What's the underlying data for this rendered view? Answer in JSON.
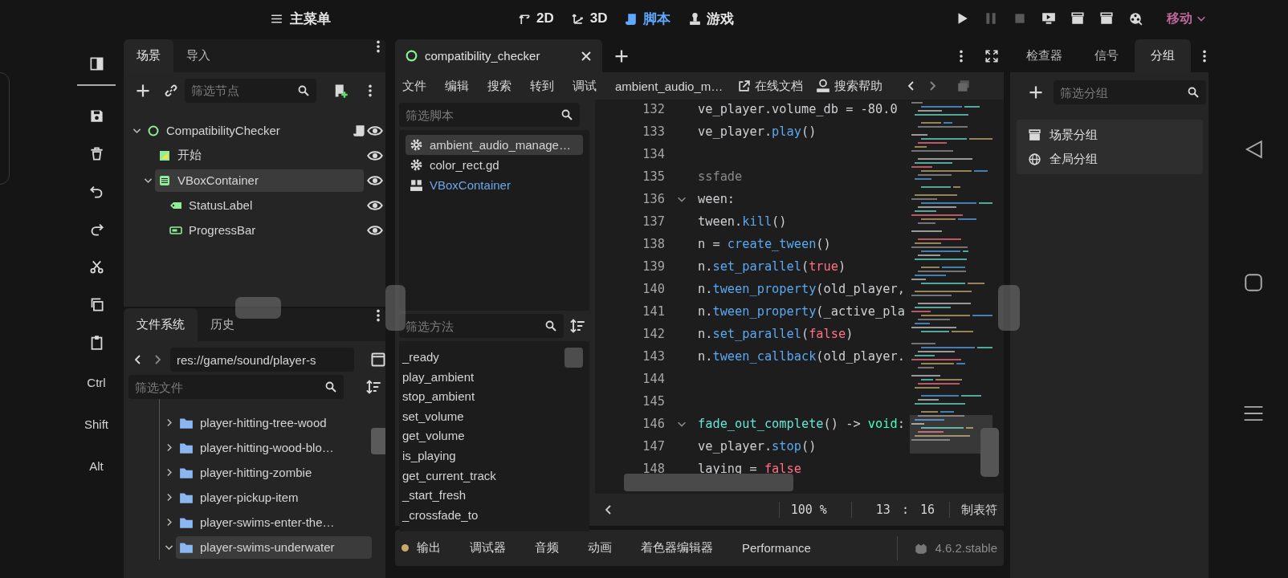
{
  "main_menu": "主菜单",
  "workspaces": [
    {
      "label": "2D",
      "selected": false
    },
    {
      "label": "3D",
      "selected": false
    },
    {
      "label": "脚本",
      "selected": true
    },
    {
      "label": "游戏",
      "selected": false
    }
  ],
  "run_controls": [
    {
      "disabled": false
    },
    {
      "disabled": true
    },
    {
      "disabled": true
    },
    {
      "disabled": false
    },
    {
      "disabled": false
    },
    {
      "disabled": false
    },
    {
      "disabled": false
    }
  ],
  "mode": "移动",
  "modifier_keys": [
    "Ctrl",
    "Shift",
    "Alt"
  ],
  "scene_dock": {
    "tabs": [
      {
        "label": "场景",
        "selected": true
      },
      {
        "label": "导入",
        "selected": false
      }
    ],
    "filter_placeholder": "筛选节点",
    "tree": [
      {
        "name": "CompatibilityChecker",
        "kind": "node",
        "selected": false,
        "visible": true,
        "has_script": true,
        "expanded": true,
        "children": [
          {
            "name": "开始",
            "kind": "color_rect",
            "selected": false,
            "visible": true,
            "has_script": false
          },
          {
            "name": "VBoxContainer",
            "kind": "vbox",
            "selected": true,
            "visible": true,
            "has_script": false,
            "expanded": true,
            "children": [
              {
                "name": "StatusLabel",
                "kind": "label",
                "selected": false,
                "visible": true,
                "has_script": false
              },
              {
                "name": "ProgressBar",
                "kind": "progress_bar",
                "selected": false,
                "visible": true,
                "has_script": false
              }
            ]
          }
        ]
      }
    ]
  },
  "filesystem_dock": {
    "tabs": [
      {
        "label": "文件系统",
        "selected": true
      },
      {
        "label": "历史",
        "selected": false
      }
    ],
    "path": "res://game/sound/player-s",
    "filter_placeholder": "筛选文件",
    "items": [
      {
        "name": "player-hitting-tree-wood",
        "selected": false,
        "expanded": false
      },
      {
        "name": "player-hitting-wood-blo…",
        "selected": false,
        "expanded": false
      },
      {
        "name": "player-hitting-zombie",
        "selected": false,
        "expanded": false
      },
      {
        "name": "player-pickup-item",
        "selected": false,
        "expanded": false
      },
      {
        "name": "player-swims-enter-the…",
        "selected": false,
        "expanded": false
      },
      {
        "name": "player-swims-underwater",
        "selected": true,
        "expanded": true
      }
    ]
  },
  "script_editor": {
    "tabs": [
      {
        "label": "compatibility_checker",
        "selected": true
      }
    ],
    "menu": [
      "文件",
      "编辑",
      "搜索",
      "转到",
      "调试"
    ],
    "current_script": "ambient_audio_m…",
    "online_docs": "在线文档",
    "search_help": "搜索帮助",
    "script_filter_placeholder": "筛选脚本",
    "scripts": [
      {
        "name": "ambient_audio_manage…",
        "kind": "script",
        "selected": true
      },
      {
        "name": "color_rect.gd",
        "kind": "script",
        "selected": false
      },
      {
        "name": "VBoxContainer",
        "kind": "doc",
        "selected": false
      }
    ],
    "method_filter_placeholder": "筛选方法",
    "methods": [
      "_ready",
      "play_ambient",
      "stop_ambient",
      "set_volume",
      "get_volume",
      "is_playing",
      "get_current_track",
      "_start_fresh",
      "_crossfade_to"
    ],
    "code_lines": [
      {
        "number": "132",
        "foldable": false,
        "tokens": [
          {
            "kind": "plain",
            "text": "ve_player.volume_db = -80.0"
          }
        ]
      },
      {
        "number": "133",
        "foldable": false,
        "tokens": [
          {
            "kind": "plain",
            "text": "ve_player."
          },
          {
            "kind": "method",
            "text": "play"
          },
          {
            "kind": "plain",
            "text": "()"
          }
        ]
      },
      {
        "number": "134",
        "foldable": false
      },
      {
        "number": "135",
        "foldable": false,
        "tokens": [
          {
            "kind": "comment",
            "text": "ssfade"
          }
        ]
      },
      {
        "number": "136",
        "foldable": true,
        "tokens": [
          {
            "kind": "plain",
            "text": "ween:"
          }
        ]
      },
      {
        "number": "137",
        "foldable": false,
        "tokens": [
          {
            "kind": "plain",
            "text": "tween."
          },
          {
            "kind": "method",
            "text": "kill"
          },
          {
            "kind": "plain",
            "text": "()"
          }
        ]
      },
      {
        "number": "138",
        "foldable": false,
        "tokens": [
          {
            "kind": "plain",
            "text": "n = "
          },
          {
            "kind": "method",
            "text": "create_tween"
          },
          {
            "kind": "plain",
            "text": "()"
          }
        ]
      },
      {
        "number": "139",
        "foldable": false,
        "tokens": [
          {
            "kind": "plain",
            "text": "n."
          },
          {
            "kind": "method",
            "text": "set_parallel"
          },
          {
            "kind": "plain",
            "text": "("
          },
          {
            "kind": "keyword",
            "text": "true"
          },
          {
            "kind": "plain",
            "text": ")"
          }
        ]
      },
      {
        "number": "140",
        "foldable": false,
        "tokens": [
          {
            "kind": "plain",
            "text": "n."
          },
          {
            "kind": "method",
            "text": "tween_property"
          },
          {
            "kind": "plain",
            "text": "(old_player,"
          }
        ]
      },
      {
        "number": "141",
        "foldable": false,
        "tokens": [
          {
            "kind": "plain",
            "text": "n."
          },
          {
            "kind": "method",
            "text": "tween_property"
          },
          {
            "kind": "plain",
            "text": "(_active_pla"
          }
        ]
      },
      {
        "number": "142",
        "foldable": false,
        "tokens": [
          {
            "kind": "plain",
            "text": "n."
          },
          {
            "kind": "method",
            "text": "set_parallel"
          },
          {
            "kind": "plain",
            "text": "("
          },
          {
            "kind": "keyword",
            "text": "false"
          },
          {
            "kind": "plain",
            "text": ")"
          }
        ]
      },
      {
        "number": "143",
        "foldable": false,
        "tokens": [
          {
            "kind": "plain",
            "text": "n."
          },
          {
            "kind": "method",
            "text": "tween_callback"
          },
          {
            "kind": "plain",
            "text": "(old_player."
          }
        ]
      },
      {
        "number": "144",
        "foldable": false
      },
      {
        "number": "145",
        "foldable": false
      },
      {
        "number": "146",
        "foldable": true,
        "tokens": [
          {
            "kind": "function",
            "text": "fade_out_complete"
          },
          {
            "kind": "plain",
            "text": "() -> "
          },
          {
            "kind": "type",
            "text": "void"
          },
          {
            "kind": "plain",
            "text": ":"
          }
        ]
      },
      {
        "number": "147",
        "foldable": false,
        "tokens": [
          {
            "kind": "plain",
            "text": "ve_player."
          },
          {
            "kind": "method",
            "text": "stop"
          },
          {
            "kind": "plain",
            "text": "()"
          }
        ]
      },
      {
        "number": "148",
        "foldable": false,
        "tokens": [
          {
            "kind": "plain",
            "text": "laying = "
          },
          {
            "kind": "keyword",
            "text": "false"
          }
        ]
      }
    ],
    "status": {
      "zoom": "100 %",
      "line": "13",
      "separator": ":",
      "column": "16",
      "indent": "制表符"
    }
  },
  "bottom_panel": {
    "tabs": [
      {
        "label": "输出",
        "has_dot": true
      },
      {
        "label": "调试器",
        "has_dot": false
      },
      {
        "label": "音频",
        "has_dot": false
      },
      {
        "label": "动画",
        "has_dot": false
      },
      {
        "label": "着色器编辑器",
        "has_dot": false
      },
      {
        "label": "Performance",
        "has_dot": false
      }
    ],
    "version": "4.6.2.stable"
  },
  "right_dock": {
    "tabs": [
      {
        "label": "检查器",
        "selected": false
      },
      {
        "label": "信号",
        "selected": false
      },
      {
        "label": "分组",
        "selected": true
      }
    ],
    "filter_placeholder": "筛选分组",
    "groups": [
      {
        "label": "场景分组",
        "kind": "scene"
      },
      {
        "label": "全局分组",
        "kind": "global"
      }
    ]
  }
}
